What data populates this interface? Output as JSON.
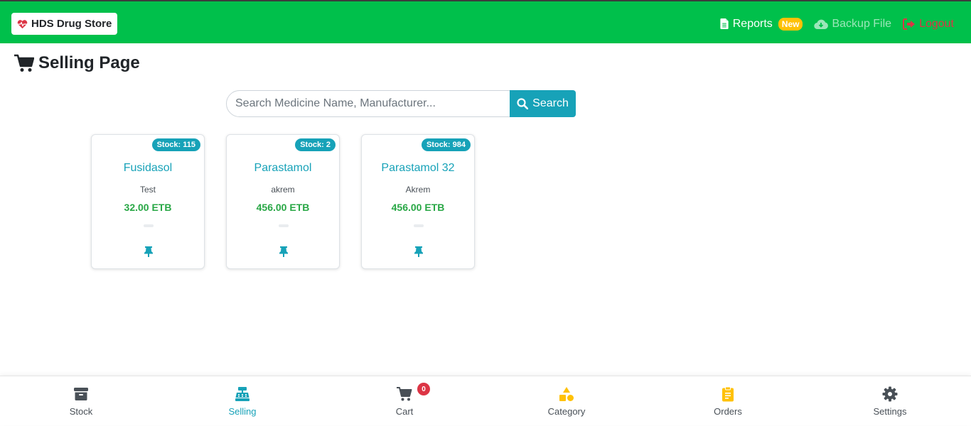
{
  "app": {
    "brand": "HDS Drug Store"
  },
  "nav": {
    "reports": "Reports",
    "reports_badge": "New",
    "backup": "Backup File",
    "logout": "Logout"
  },
  "page": {
    "title": "Selling Page"
  },
  "search": {
    "placeholder": "Search Medicine Name, Manufacturer...",
    "button": "Search"
  },
  "products": [
    {
      "stock": "Stock: 115",
      "name": "Fusidasol",
      "manufacturer": "Test",
      "price": "32.00 ETB"
    },
    {
      "stock": "Stock: 2",
      "name": "Parastamol",
      "manufacturer": "akrem",
      "price": "456.00 ETB"
    },
    {
      "stock": "Stock: 984",
      "name": "Parastamol 32",
      "manufacturer": "Akrem",
      "price": "456.00 ETB"
    }
  ],
  "bottom_nav": {
    "stock": "Stock",
    "selling": "Selling",
    "cart": "Cart",
    "cart_count": "0",
    "category": "Category",
    "orders": "Orders",
    "settings": "Settings"
  },
  "colors": {
    "navbar": "#00c04b",
    "accent": "#17a2b8",
    "price": "#28a745",
    "danger": "#dc3545",
    "warning": "#ffc107"
  }
}
